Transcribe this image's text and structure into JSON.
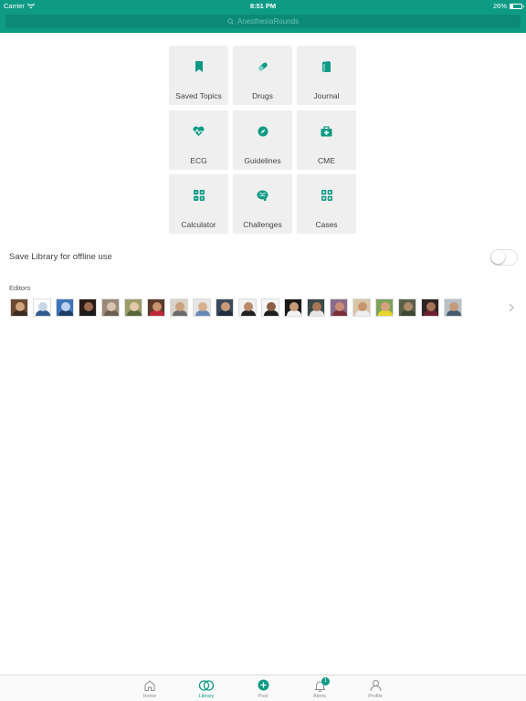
{
  "status_bar": {
    "carrier": "Carrier",
    "time": "8:51 PM",
    "battery": "26%",
    "battery_level": 0.26
  },
  "search": {
    "placeholder": "AnesthesiaRounds"
  },
  "tiles": [
    {
      "label": "Saved Topics",
      "icon": "bookmark-icon"
    },
    {
      "label": "Drugs",
      "icon": "pill-icon"
    },
    {
      "label": "Journal",
      "icon": "book-icon"
    },
    {
      "label": "ECG",
      "icon": "heart-pulse-icon"
    },
    {
      "label": "Guidelines",
      "icon": "compass-icon"
    },
    {
      "label": "CME",
      "icon": "medical-kit-icon"
    },
    {
      "label": "Calculator",
      "icon": "calculator-grid-icon"
    },
    {
      "label": "Challenges",
      "icon": "brain-icon"
    },
    {
      "label": "Cases",
      "icon": "cases-grid-icon"
    }
  ],
  "offline": {
    "label": "Save Library for offline use",
    "enabled": false
  },
  "editors": {
    "title": "Editors",
    "count": 20
  },
  "tabbar": {
    "items": [
      {
        "label": "Home",
        "icon": "home-icon",
        "active": false
      },
      {
        "label": "Library",
        "icon": "library-rings-icon",
        "active": true
      },
      {
        "label": "Post",
        "icon": "add-circle-icon",
        "active": false
      },
      {
        "label": "Alerts",
        "icon": "bell-icon",
        "active": false,
        "badge": "1"
      },
      {
        "label": "Profile",
        "icon": "person-icon",
        "active": false
      }
    ]
  },
  "colors": {
    "brand": "#0e9b86",
    "tile_bg": "#efefef",
    "inactive_tab": "#8e8e8e"
  }
}
